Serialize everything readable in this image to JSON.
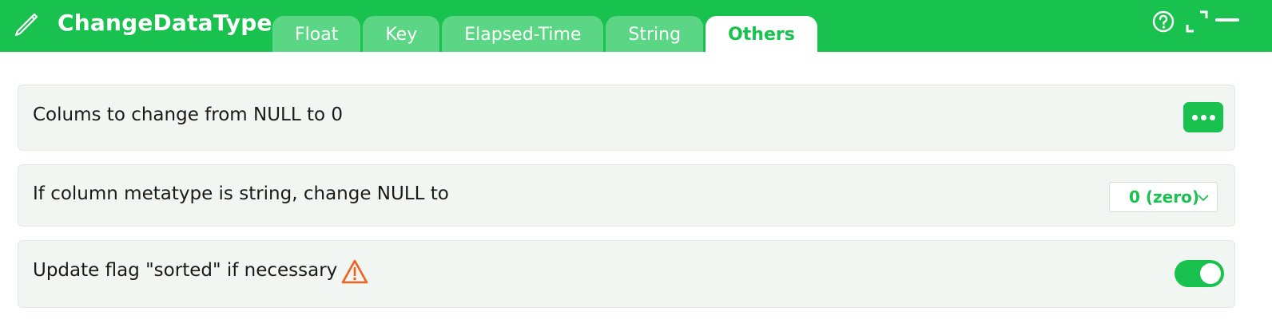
{
  "header": {
    "title": "ChangeDataType",
    "icon": "pencil-icon",
    "color": "#19c24e"
  },
  "tabs": [
    {
      "label": "Float",
      "active": false
    },
    {
      "label": "Key",
      "active": false
    },
    {
      "label": "Elapsed-Time",
      "active": false
    },
    {
      "label": "String",
      "active": false
    },
    {
      "label": "Others",
      "active": true
    }
  ],
  "window_controls": [
    "help-icon",
    "expand-icon",
    "minimize-icon"
  ],
  "settings": {
    "null_to_zero": {
      "label": "Colums to change from NULL to 0",
      "action_icon": "more-horizontal-icon"
    },
    "string_null": {
      "label": "If column metatype is string, change NULL to",
      "selected": "0 (zero)"
    },
    "sorted_flag": {
      "label": "Update flag \"sorted\" if necessary",
      "warning_icon": "warning-icon",
      "warning_color": "#f0601e",
      "enabled": true
    }
  }
}
